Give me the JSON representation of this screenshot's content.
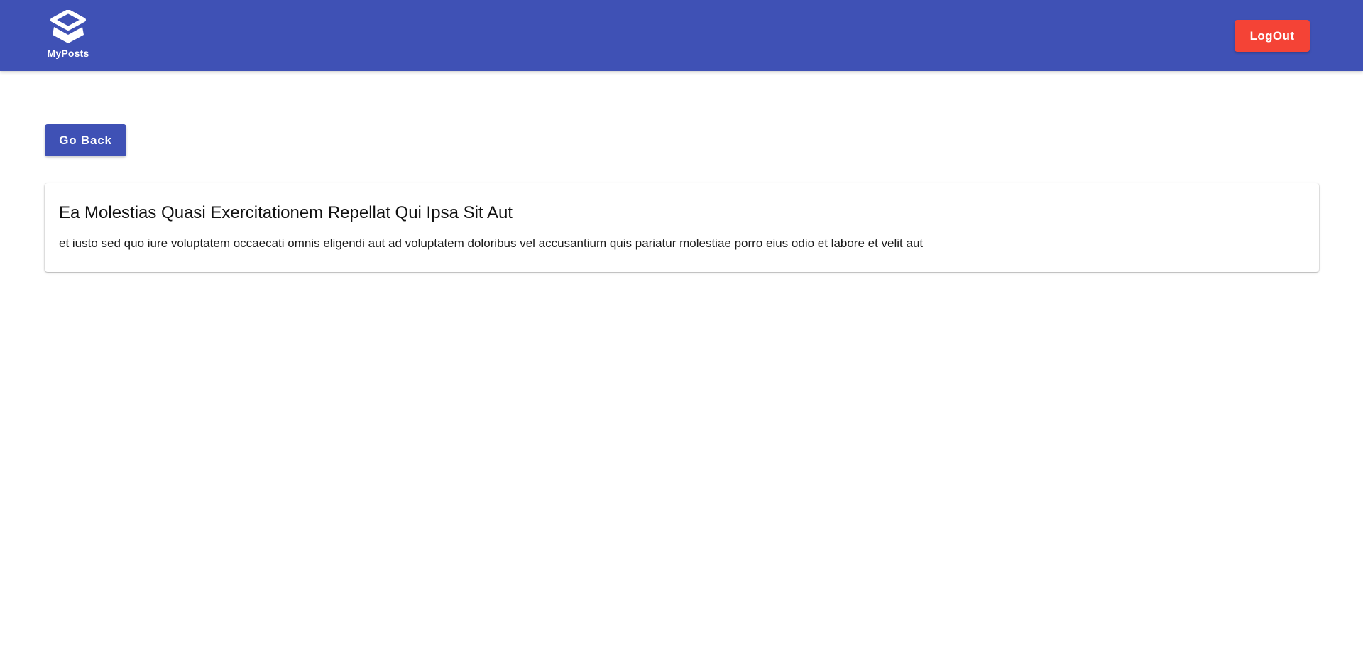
{
  "header": {
    "brand_name": "MyPosts",
    "logo_icon": "layers-logo-icon",
    "logout_label": "LogOut",
    "bar_color": "#3f51b5",
    "logout_color": "#f44336"
  },
  "main": {
    "back_label": "Go Back",
    "post": {
      "title": "Ea Molestias Quasi Exercitationem Repellat Qui Ipsa Sit Aut",
      "body": "et iusto sed quo iure voluptatem occaecati omnis eligendi aut ad voluptatem doloribus vel accusantium quis pariatur molestiae porro eius odio et labore et velit aut"
    }
  }
}
